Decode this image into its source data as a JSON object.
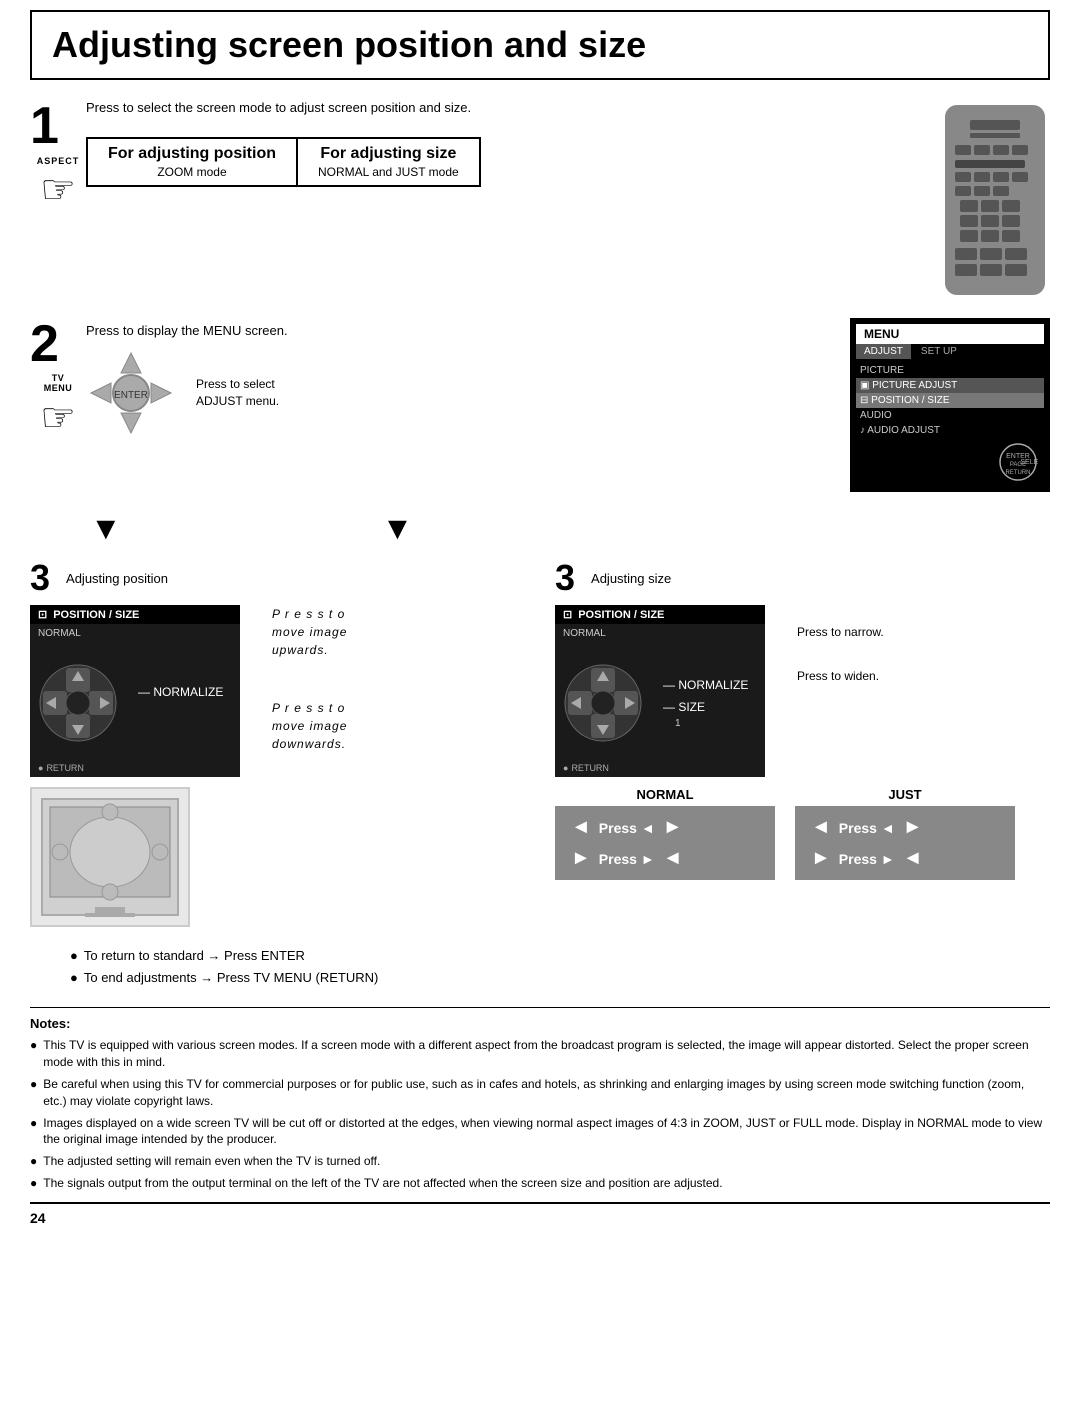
{
  "page": {
    "title": "Adjusting screen position and size",
    "page_number": "24"
  },
  "step1": {
    "number": "1",
    "aspect_label": "ASPECT",
    "instruction": "Press to select the screen mode to adjust screen position and size.",
    "for_position_label": "For adjusting position",
    "for_position_sub": "ZOOM mode",
    "for_size_label": "For adjusting size",
    "for_size_sub": "NORMAL and JUST mode"
  },
  "step2": {
    "number": "2",
    "tv_menu_label": "TV\nMENU",
    "instruction": "Press to display the MENU screen.",
    "select_label": "Press to select\nADJUST menu.",
    "menu": {
      "title": "MENU",
      "tabs": [
        "ADJUST",
        "SET UP"
      ],
      "active_tab": "ADJUST",
      "items": [
        "PICTURE",
        "PICTURE ADJUST",
        "POSITION / SIZE",
        "AUDIO",
        "AUDIO ADJUST"
      ],
      "selected_item": "POSITION / SIZE"
    }
  },
  "step3_left": {
    "number": "3",
    "label": "Adjusting position",
    "screen_header": "POSITION / SIZE",
    "screen_items": [
      "NORMAL",
      "NORMALIZE"
    ],
    "return_label": "RETURN",
    "press_up": "P r e s s  t o\nmove image\nupwards.",
    "press_down": "P r e s s  t o\nmove image\ndownwards."
  },
  "step3_right": {
    "number": "3",
    "label": "Adjusting size",
    "screen_header": "POSITION / SIZE",
    "screen_items": [
      "NORMAL",
      "NORMALIZE",
      "SIZE",
      "1"
    ],
    "return_label": "RETURN",
    "press_narrow": "Press to narrow.",
    "press_widen": "Press to widen.",
    "normal_label": "NORMAL",
    "just_label": "JUST",
    "press_rows_normal": [
      {
        "left_arrow": "◄",
        "text": "Press ◄",
        "right_arrow": "►"
      },
      {
        "left_arrow": "►",
        "text": "Press ►",
        "right_arrow": "◄"
      }
    ],
    "press_rows_just": [
      {
        "left_arrow": "◄",
        "text": "Press ◄",
        "right_arrow": "►"
      },
      {
        "left_arrow": "►",
        "text": "Press ►",
        "right_arrow": "◄"
      }
    ]
  },
  "tips": [
    "To return to standard → Press ENTER",
    "To end adjustments → Press TV MENU (RETURN)"
  ],
  "notes": {
    "title": "Notes:",
    "items": [
      "This TV is equipped with various screen modes. If a screen mode with a different aspect from the broadcast program is selected, the image will appear distorted. Select the proper screen mode with this in mind.",
      "Be careful when using this TV for commercial purposes or for public use, such as in cafes and hotels, as shrinking and enlarging images by using screen mode switching function (zoom, etc.) may violate copyright laws.",
      "Images displayed on a wide screen TV will be cut off or distorted at the edges, when viewing normal aspect images of 4:3 in ZOOM, JUST or FULL mode. Display in NORMAL mode to view the original image intended by the producer.",
      "The adjusted setting will remain even when the TV is turned off.",
      "The signals output from the output terminal on the left of the TV are not affected when the screen size and position are adjusted."
    ]
  }
}
